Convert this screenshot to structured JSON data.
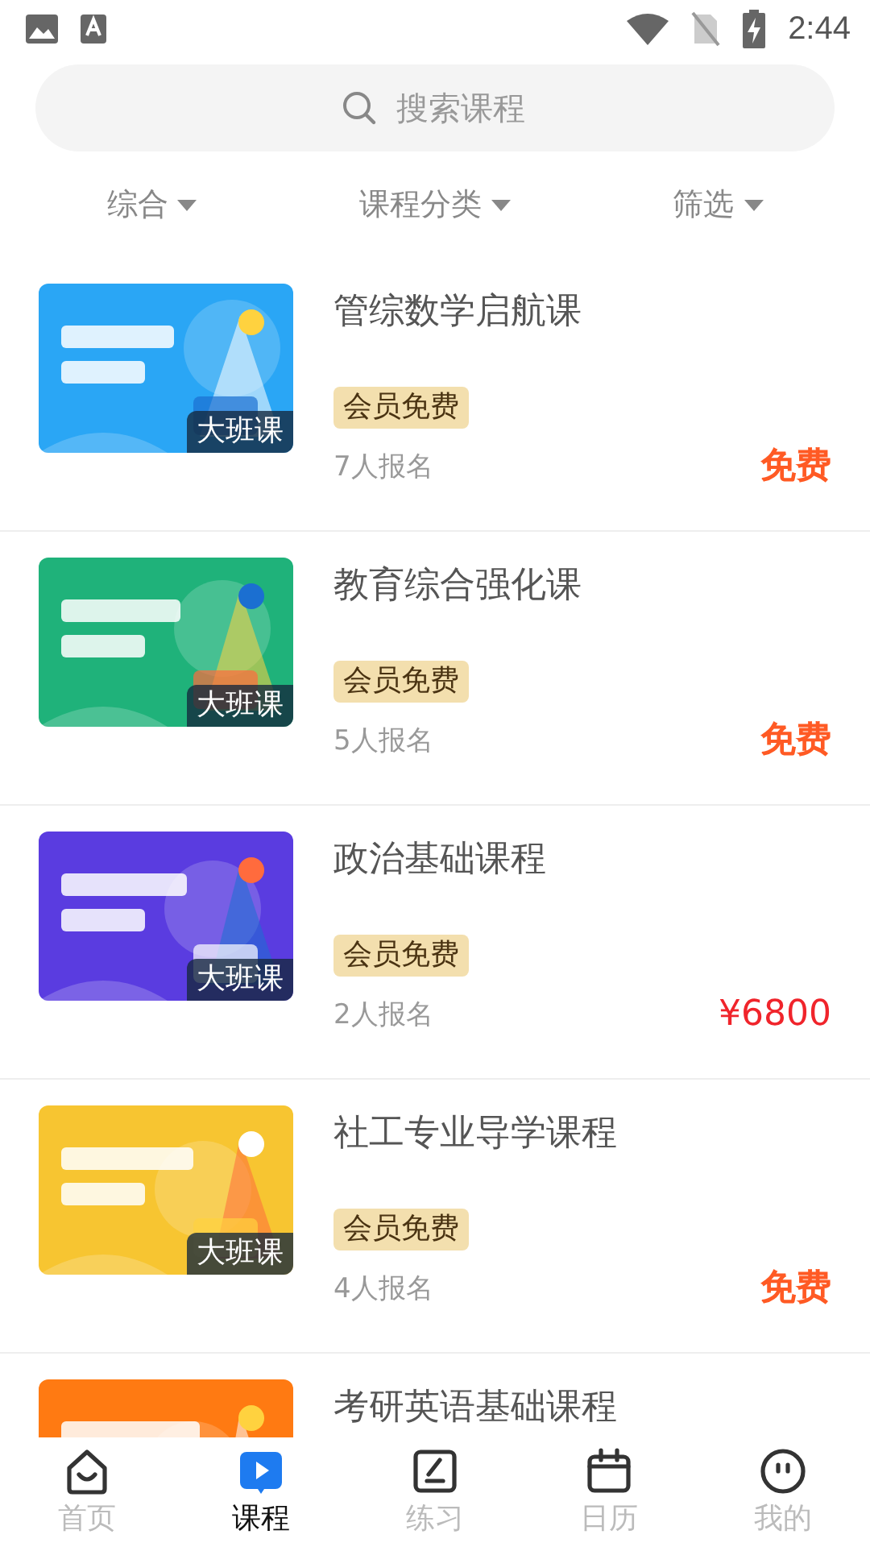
{
  "status_bar": {
    "time": "2:44"
  },
  "search": {
    "placeholder": "搜索课程"
  },
  "filters": [
    {
      "label": "综合"
    },
    {
      "label": "课程分类"
    },
    {
      "label": "筛选"
    }
  ],
  "courses": [
    {
      "title": "管综数学启航课",
      "class_type": "大班课",
      "tag": "会员免费",
      "enrolled": "7人报名",
      "price": "免费",
      "kind": "free"
    },
    {
      "title": "教育综合强化课",
      "class_type": "大班课",
      "tag": "会员免费",
      "enrolled": "5人报名",
      "price": "免费",
      "kind": "free"
    },
    {
      "title": "政治基础课程",
      "class_type": "大班课",
      "tag": "会员免费",
      "enrolled": "2人报名",
      "price": "¥6800",
      "kind": "paid"
    },
    {
      "title": "社工专业导学课程",
      "class_type": "大班课",
      "tag": "会员免费",
      "enrolled": "4人报名",
      "price": "免费",
      "kind": "free"
    },
    {
      "title": "考研英语基础课程"
    }
  ],
  "tab_bar": [
    {
      "label": "首页",
      "selected": false
    },
    {
      "label": "课程",
      "selected": true
    },
    {
      "label": "练习",
      "selected": false
    },
    {
      "label": "日历",
      "selected": false
    },
    {
      "label": "我的",
      "selected": false
    }
  ]
}
